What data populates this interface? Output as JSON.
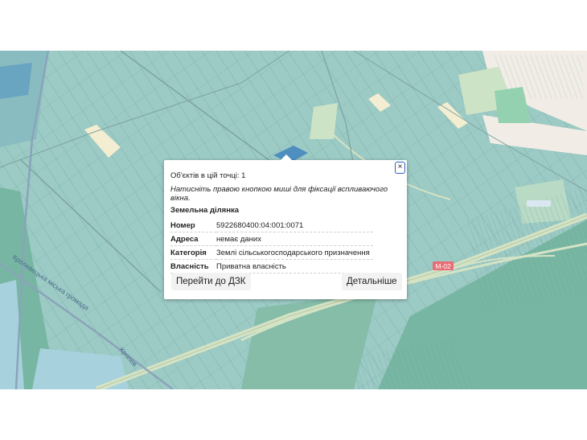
{
  "map": {
    "labels": {
      "road": "М-02",
      "community": "Кролевецька міська громада",
      "community_short": "Кролев"
    },
    "colors": {
      "field": "#9ccac4",
      "forest": "#74b39f",
      "road": "#d5e3c5",
      "parcel_line": "#6f9d99",
      "boundary": "#8aa4bb"
    }
  },
  "popup": {
    "close_label": "×",
    "count_text": "Об'єктів в цій точці: 1",
    "hint_text": "Натисніть правою кнопкою миші для фіксації вспливаючого вікна.",
    "section_title": "Земельна ділянка",
    "rows": [
      {
        "key": "Номер",
        "value": "5922680400:04:001:0071"
      },
      {
        "key": "Адреса",
        "value": "немає даних"
      },
      {
        "key": "Категорія",
        "value": "Землі сільськогосподарського призначення"
      },
      {
        "key": "Власність",
        "value": "Приватна власність"
      }
    ],
    "btn_dzk": "Перейти до ДЗК",
    "btn_details": "Детальніше"
  }
}
